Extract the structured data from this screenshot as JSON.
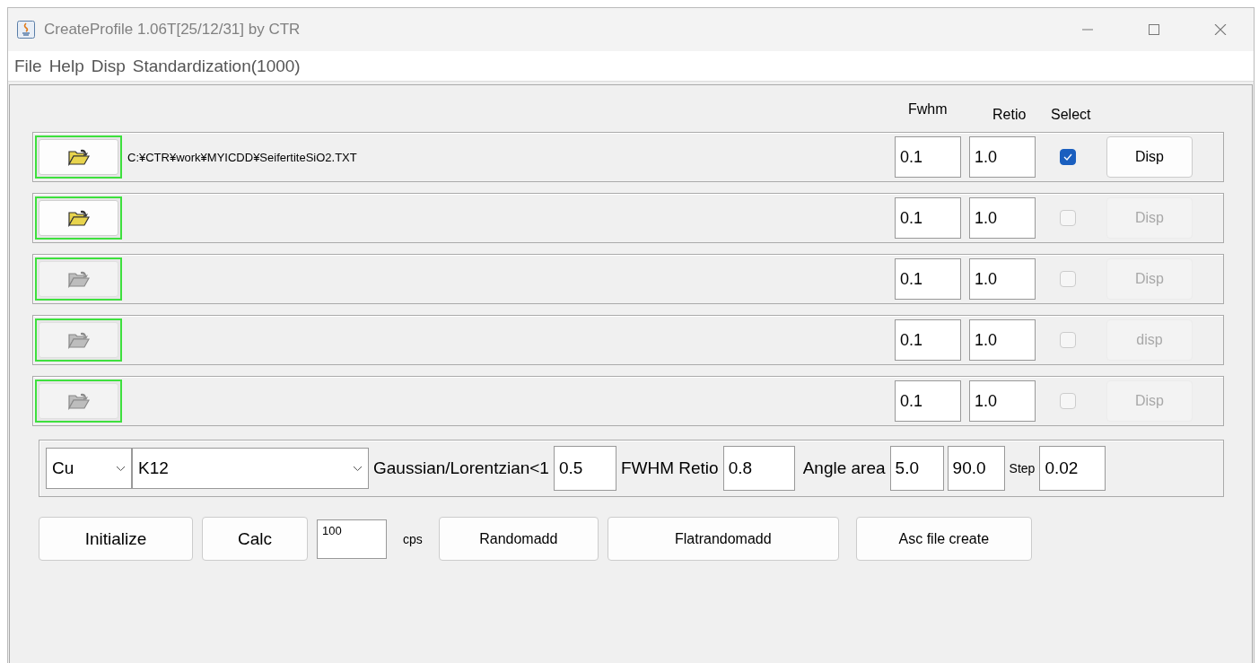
{
  "window": {
    "title": "CreateProfile 1.06T[25/12/31] by CTR"
  },
  "menu": [
    "File",
    "Help",
    "Disp",
    "Standardization(1000)"
  ],
  "columns": [
    "Fwhm",
    "Retio",
    "Select"
  ],
  "rows": [
    {
      "folder_enabled": true,
      "path": "C:¥CTR¥work¥MYICDD¥SeifertiteSiO2.TXT",
      "fwhm": "0.1",
      "retio": "1.0",
      "checked": true,
      "disp_label": "Disp",
      "disp_enabled": true
    },
    {
      "folder_enabled": true,
      "fwhm": "0.1",
      "retio": "1.0",
      "checked": false,
      "disp_label": "Disp",
      "disp_enabled": false
    },
    {
      "folder_enabled": false,
      "fwhm": "0.1",
      "retio": "1.0",
      "checked": false,
      "disp_label": "Disp",
      "disp_enabled": false
    },
    {
      "folder_enabled": false,
      "fwhm": "0.1",
      "retio": "1.0",
      "checked": false,
      "disp_label": "disp",
      "disp_enabled": false
    },
    {
      "folder_enabled": false,
      "fwhm": "0.1",
      "retio": "1.0",
      "checked": false,
      "disp_label": "Disp",
      "disp_enabled": false
    }
  ],
  "settings": {
    "target": "Cu",
    "line": "K12",
    "gl_label": "Gaussian/Lorentzian<1",
    "gl_value": "0.5",
    "fwhm_ratio_label": "FWHM Retio",
    "fwhm_ratio_value": "0.8",
    "angle_label": "Angle area",
    "angle_from": "5.0",
    "angle_to": "90.0",
    "step_label": "Step",
    "step_value": "0.02"
  },
  "actions": {
    "initialize": "Initialize",
    "calc": "Calc",
    "cps_value": "100",
    "cps_label": "cps",
    "randomadd": "Randomadd",
    "flatrandomadd": "Flatrandomadd",
    "asc": "Asc file create"
  }
}
